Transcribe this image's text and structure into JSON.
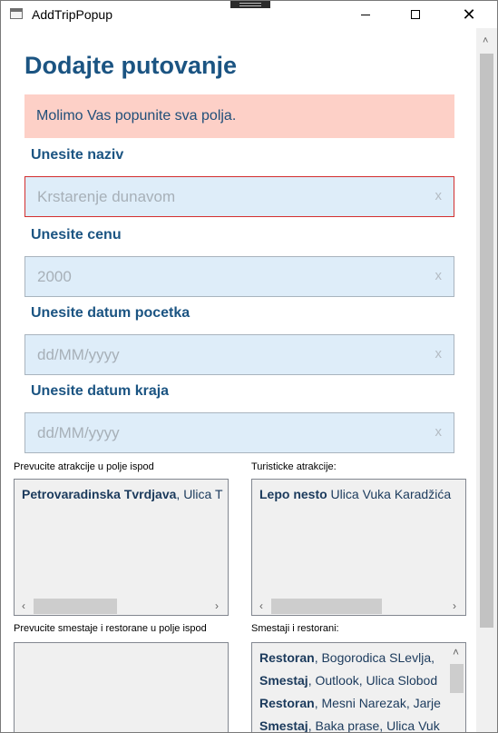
{
  "window": {
    "title": "AddTripPopup",
    "close_glyph": "✕"
  },
  "form": {
    "heading": "Dodajte putovanje",
    "alert": "Molimo Vas popunite sva polja.",
    "clear_glyph": "x",
    "fields": [
      {
        "label": "Unesite naziv",
        "placeholder": "Krstarenje dunavom",
        "invalid": true
      },
      {
        "label": "Unesite cenu",
        "placeholder": "2000",
        "invalid": false
      },
      {
        "label": "Unesite datum pocetka",
        "placeholder": "dd/MM/yyyy",
        "invalid": false
      },
      {
        "label": "Unesite datum kraja",
        "placeholder": "dd/MM/yyyy",
        "invalid": false
      }
    ]
  },
  "lists": {
    "arrow_left": "‹",
    "arrow_right": "›",
    "arrow_up": "˄",
    "selected_attractions": {
      "label": "Prevucite atrakcije u polje ispod",
      "items": [
        {
          "bold": "Petrovaradinska Tvrdjava",
          "rest": ", Ulica T"
        }
      ]
    },
    "available_attractions": {
      "label": "Turisticke atrakcije:",
      "items": [
        {
          "bold": "Lepo nesto",
          "rest": " Ulica Vuka Karadžića"
        }
      ]
    },
    "selected_accommodations": {
      "label": "Prevucite smestaje i restorane u polje ispod",
      "items": []
    },
    "available_accommodations": {
      "label": "Smestaji i restorani:",
      "items": [
        {
          "bold": "Restoran",
          "rest": ", Bogorodica SLevlja, "
        },
        {
          "bold": "Smestaj",
          "rest": ", Outlook, Ulica Slobod"
        },
        {
          "bold": "Restoran",
          "rest": ", Mesni Narezak, Jarje"
        },
        {
          "bold": "Smestaj",
          "rest": ", Baka prase, Ulica Vuk"
        }
      ]
    }
  },
  "colors": {
    "heading": "#1b5482",
    "alert_bg": "#fdd0c7",
    "field_bg": "#deedf9",
    "invalid_border": "#d32f2f"
  }
}
